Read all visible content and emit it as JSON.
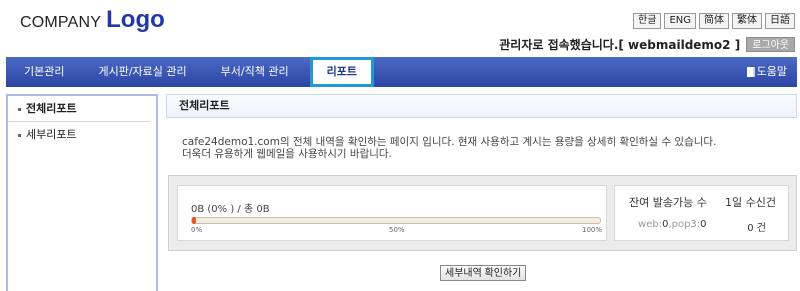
{
  "header": {
    "company": "COMPANY",
    "logo": "Logo",
    "languages": [
      "한글",
      "ENG",
      "简体",
      "繁体",
      "日語"
    ],
    "welcome": "관리자로 접속했습니다.[ webmaildemo2 ]",
    "logout": "로그아웃"
  },
  "nav": {
    "items": [
      "기본관리",
      "게시판/자료실 관리",
      "부서/직책 관리",
      "리포트"
    ],
    "active": "리포트",
    "help": "도움말",
    "help_icon": "document-icon"
  },
  "sidebar": {
    "items": [
      "전체리포트",
      "세부리포트"
    ],
    "selected": "전체리포트"
  },
  "main": {
    "title": "전체리포트",
    "description_line1": "cafe24demo1.com의 전체 내역을 확인하는 페이지 입니다. 현재 사용하고 계시는 용량을 상세히 확인하실 수 있습니다.",
    "description_line2": "더욱더 유용하게 웹메일을 사용하시기 바랍니다.",
    "usage": {
      "text": "0B (0% ) / 총 0B",
      "percent": 0,
      "ticks": [
        "0%",
        "50%",
        "100%"
      ]
    },
    "stats": {
      "col1_header": "잔여 발송가능 수",
      "col2_header": "1일 수신건",
      "web_label": "web:",
      "web_value": "0",
      "pop3_label": ",pop3:",
      "pop3_value": "0",
      "daily_received": "0 건"
    },
    "detail_button": "세부내역 확인하기"
  },
  "colors": {
    "nav_bg": "#3452b2",
    "active_tab_border": "#1f9ad6",
    "logo_blue": "#2237a8",
    "bar_fill": "#e6632a"
  }
}
